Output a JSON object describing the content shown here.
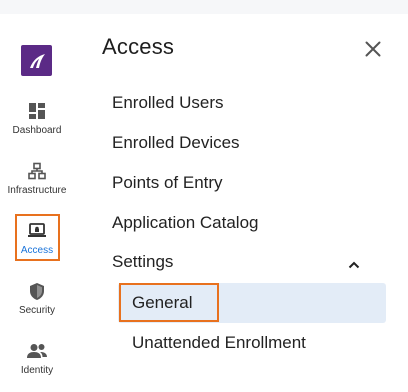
{
  "rail": {
    "items": [
      {
        "label": "Dashboard",
        "icon": "dashboard-icon"
      },
      {
        "label": "Infrastructure",
        "icon": "infrastructure-icon"
      },
      {
        "label": "Access",
        "icon": "access-icon",
        "active": true
      },
      {
        "label": "Security",
        "icon": "shield-icon"
      },
      {
        "label": "Identity",
        "icon": "people-icon"
      }
    ]
  },
  "panel": {
    "title": "Access",
    "items": [
      "Enrolled Users",
      "Enrolled Devices",
      "Points of Entry",
      "Application Catalog"
    ],
    "settings": {
      "label": "Settings",
      "expanded": true,
      "sub_items": [
        "General",
        "Unattended Enrollment"
      ],
      "selected": "General"
    }
  },
  "colors": {
    "logo": "#5b2a86",
    "highlight_outline": "#e8711e",
    "selected_bg": "#e3ecf7",
    "active_label": "#1a73d9"
  }
}
